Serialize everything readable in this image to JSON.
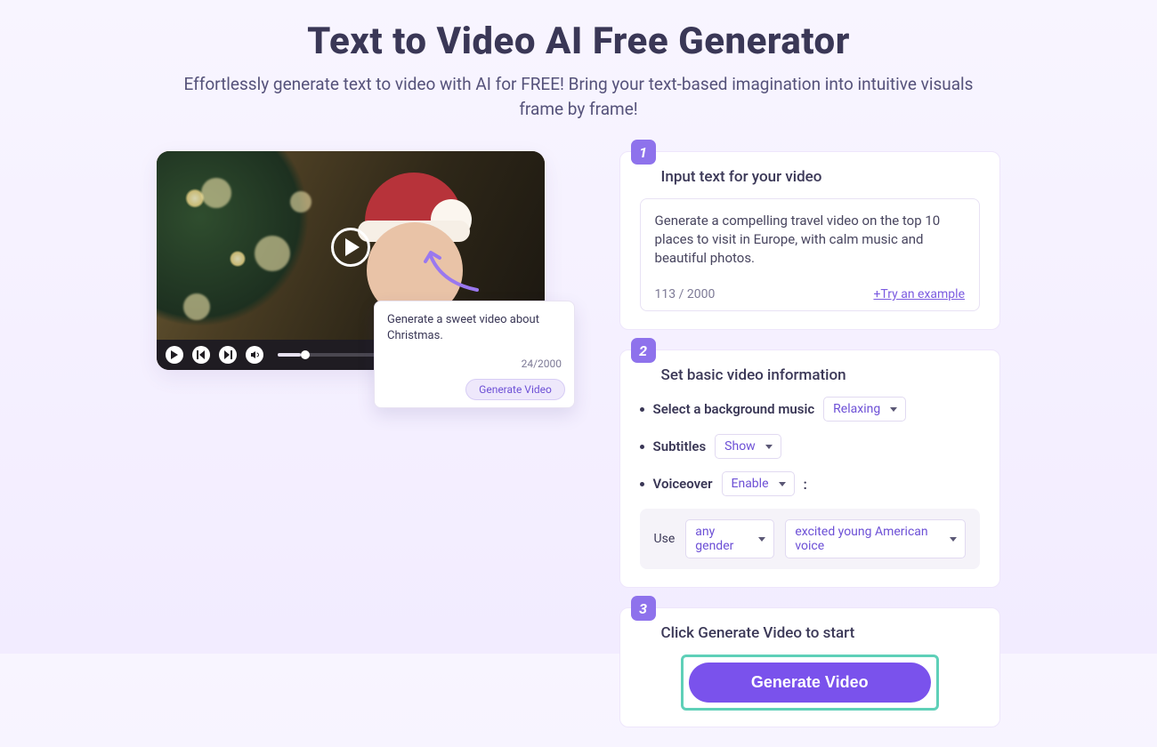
{
  "header": {
    "title": "Text to Video AI Free Generator",
    "subtitle_line1": "Effortlessly generate text to video with AI for FREE! Bring your text-based imagination into intuitive visuals",
    "subtitle_line2": "frame by frame!"
  },
  "preview": {
    "caption_text": "Generate a sweet video about Christmas.",
    "caption_count": "24/2000",
    "mini_button": "Generate Video"
  },
  "step1": {
    "badge": "1",
    "title": "Input text for your video",
    "text": "Generate a compelling travel video on the top 10 places to visit in Europe, with calm music and beautiful photos.",
    "char_count": "113 / 2000",
    "try_link": "+Try an example"
  },
  "step2": {
    "badge": "2",
    "title": "Set basic video information",
    "bg_music_label": "Select a background music",
    "bg_music_value": "Relaxing",
    "subtitles_label": "Subtitles",
    "subtitles_value": "Show",
    "voiceover_label": "Voiceover",
    "voiceover_value": "Enable",
    "use_label": "Use",
    "gender_value": "any gender",
    "voice_value": "excited young American voice"
  },
  "step3": {
    "badge": "3",
    "title": "Click Generate Video to start",
    "button": "Generate Video"
  }
}
